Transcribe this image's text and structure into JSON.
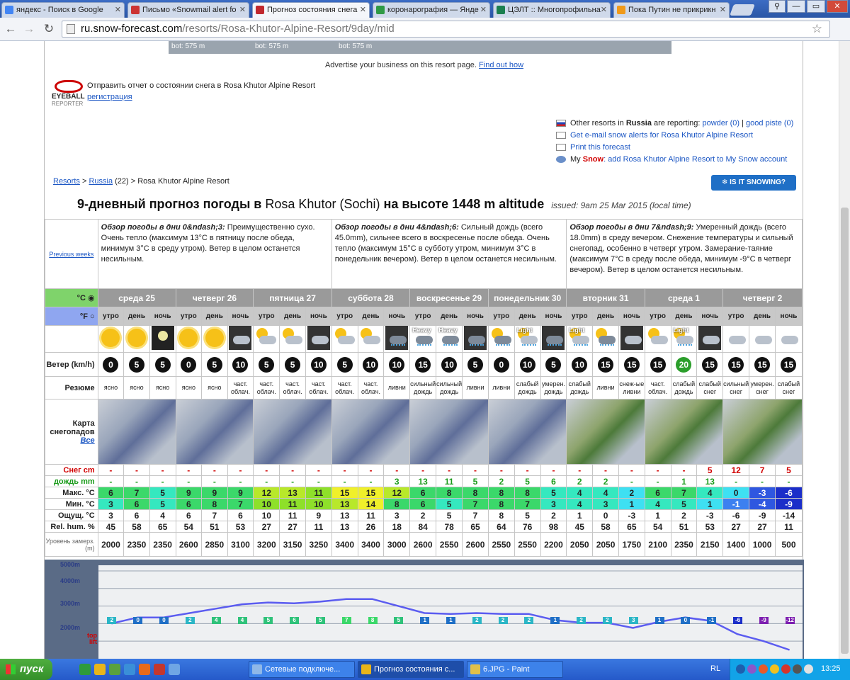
{
  "browser": {
    "tabs": [
      {
        "label": "яндекс - Поиск в Google",
        "color": "#4285f4"
      },
      {
        "label": "Письмо «Snowmail alert fo",
        "color": "#cc3333"
      },
      {
        "label": "Прогноз состояния снега",
        "color": "#c0282e"
      },
      {
        "label": "коронарография — Янде",
        "color": "#2f9a45"
      },
      {
        "label": "ЦЭЛТ :: Многопрофильна",
        "color": "#1b7f4f"
      },
      {
        "label": "Пока Путин не прикрикн",
        "color": "#f09a1a"
      }
    ],
    "url_host": "ru.snow-forecast.com",
    "url_path": "/resorts/Rosa-Khutor-Alpine-Resort/9day/mid",
    "window_buttons": [
      "⚲",
      "—",
      "▭",
      "✕"
    ]
  },
  "top_strip": [
    "bot: 575 m",
    "bot: 575 m",
    "bot: 575 m"
  ],
  "advert": {
    "text": "Advertise your business on this resort page.",
    "link": "Find out how"
  },
  "eyeball": {
    "name": "EYEBALL",
    "sub": "REPORTER",
    "text": "Отправить отчет о состоянии снега в Rosa Khutor Alpine Resort",
    "link": "регистрация"
  },
  "side_links": [
    {
      "prefix": "Other resorts in ",
      "bold": "Russia",
      "mid": " are reporting: ",
      "link1": "powder (0)",
      "sep": " | ",
      "link2": "good piste (0)"
    },
    {
      "link": "Get e-mail snow alerts for Rosa Khutor Alpine Resort"
    },
    {
      "link": "Print this forecast"
    },
    {
      "prefix": "My ",
      "red": "Snow",
      "link": ": add Rosa Khutor Alpine Resort to My Snow account"
    }
  ],
  "breadcrumb": {
    "resorts": "Resorts",
    "sep": " > ",
    "country": "Russia",
    "count": " (22) > ",
    "current": "Rosa Khutor Alpine Resort"
  },
  "snow_button": "❄ IS IT SNOWING?",
  "title": {
    "prefix": "9-дневный прогноз погоды в ",
    "location": "Rosa Khutor (Sochi)",
    "suffix": " на высоте 1448 m altitude",
    "issued": "issued: 9am 25 Mar 2015 (local time)"
  },
  "previous_weeks": "Previous weeks",
  "overviews": [
    {
      "head": "Обзор погоды в дни 0&ndash;3:",
      "text": " Преимущественно сухо. Очень тепло (максимум 13°C в пятницу после обеда, минимум 3°C в среду утром). Ветер в целом останется несильным."
    },
    {
      "head": "Обзор погоды в дни 4&ndash;6:",
      "text": " Сильный дождь (всего 45.0mm), сильнее всего в воскресенье после обеда. Очень тепло (максимум 15°C в субботу утром, минимум 3°C в понедельник вечером). Ветер в целом останется несильным."
    },
    {
      "head": "Обзор погоды в дни 7&ndash;9:",
      "text": " Умеренный дождь (всего 18.0mm) в среду вечером. Снежение температуры и сильный снегопад, особенно в четверг утром. Замерание-таяние (максимум 7°C в среду после обеда, минимум -9°C в четверг вечером). Ветер в целом останется несильным."
    }
  ],
  "units": {
    "c": "°C",
    "f": "°F"
  },
  "days": [
    "среда 25",
    "четверг 26",
    "пятница 27",
    "суббота 28",
    "воскресенье 29",
    "понедельник 30",
    "вторник 31",
    "среда 1",
    "четверг 2"
  ],
  "tod": [
    "утро",
    "день",
    "ночь"
  ],
  "row_labels": {
    "wind": "Ветер (km/h)",
    "summary": "Резюме",
    "map": "Карта снегопадов",
    "map_all": "Все",
    "snow": "Снег cm",
    "rain": "дождь mm",
    "max": "Макс. °C",
    "min": "Мин. °C",
    "feel": "Ощущ. °C",
    "hum": "Rel. hum. %",
    "freeze": "Уровень замерз. (m)"
  },
  "weather_icons": [
    "sun",
    "sun",
    "moon",
    "sun",
    "sun",
    "cloud-night",
    "cloud",
    "cloud",
    "cloud-night",
    "cloud",
    "cloud",
    "rain-night",
    "heavy",
    "heavy",
    "rain-night",
    "cloud-rain",
    "light",
    "rain-night",
    "light",
    "cloud-rain",
    "snow-night",
    "cloud",
    "light",
    "snow-night",
    "snow",
    "snow",
    "snow"
  ],
  "icon_text": {
    "heavy": "Heavy",
    "light": "Light"
  },
  "wind": [
    "0",
    "5",
    "5",
    "0",
    "5",
    "10",
    "5",
    "5",
    "10",
    "5",
    "10",
    "10",
    "15",
    "10",
    "5",
    "0",
    "10",
    "5",
    "10",
    "15",
    "15",
    "15",
    "20",
    "15",
    "15",
    "15",
    "15"
  ],
  "summary": [
    "ясно",
    "ясно",
    "ясно",
    "ясно",
    "ясно",
    "част. облач.",
    "част. облач.",
    "част. облач.",
    "част. облач.",
    "част. облач.",
    "част. облач.",
    "ливни",
    "сильный дождь",
    "сильный дождь",
    "ливни",
    "ливни",
    "слабый дождь",
    "умерен. дождь",
    "слабый дождь",
    "ливни",
    "снеж-ые ливни",
    "част. облач.",
    "слабый дождь",
    "слабый снег",
    "сильный снег",
    "умерен. снег",
    "слабый снег"
  ],
  "snow": [
    "-",
    "-",
    "-",
    "-",
    "-",
    "-",
    "-",
    "-",
    "-",
    "-",
    "-",
    "-",
    "-",
    "-",
    "-",
    "-",
    "-",
    "-",
    "-",
    "-",
    "-",
    "-",
    "-",
    "5",
    "12",
    "7",
    "5"
  ],
  "rain": [
    "-",
    "-",
    "-",
    "-",
    "-",
    "-",
    "-",
    "-",
    "-",
    "-",
    "-",
    "3",
    "13",
    "11",
    "5",
    "2",
    "5",
    "6",
    "2",
    "2",
    "-",
    "-",
    "1",
    "13",
    "-",
    "-",
    "-"
  ],
  "max": [
    "6",
    "7",
    "5",
    "9",
    "9",
    "9",
    "12",
    "13",
    "11",
    "15",
    "15",
    "12",
    "6",
    "8",
    "8",
    "8",
    "8",
    "5",
    "4",
    "4",
    "2",
    "6",
    "7",
    "4",
    "0",
    "-3",
    "-6"
  ],
  "min": [
    "3",
    "6",
    "5",
    "6",
    "8",
    "7",
    "10",
    "11",
    "10",
    "13",
    "14",
    "8",
    "6",
    "5",
    "7",
    "8",
    "7",
    "3",
    "4",
    "3",
    "1",
    "4",
    "5",
    "1",
    "-1",
    "-4",
    "-9"
  ],
  "feel": [
    "3",
    "6",
    "4",
    "6",
    "7",
    "6",
    "10",
    "11",
    "9",
    "13",
    "11",
    "3",
    "2",
    "5",
    "7",
    "8",
    "5",
    "2",
    "1",
    "0",
    "-3",
    "1",
    "2",
    "-3",
    "-6",
    "-9",
    "-14"
  ],
  "hum": [
    "45",
    "58",
    "65",
    "54",
    "51",
    "53",
    "27",
    "27",
    "11",
    "13",
    "26",
    "18",
    "84",
    "78",
    "65",
    "64",
    "76",
    "98",
    "45",
    "58",
    "65",
    "54",
    "51",
    "53",
    "27",
    "27",
    "11"
  ],
  "freeze": [
    "2000",
    "2350",
    "2350",
    "2600",
    "2850",
    "3100",
    "3200",
    "3150",
    "3250",
    "3400",
    "3400",
    "3000",
    "2600",
    "2550",
    "2600",
    "2550",
    "2550",
    "2200",
    "2050",
    "2050",
    "1750",
    "2100",
    "2350",
    "2150",
    "1400",
    "1000",
    "500"
  ],
  "chart": {
    "ylabels": [
      "5000m",
      "4000m",
      "3000m",
      "2000m"
    ],
    "top_lift": "top lift",
    "feels_badges": [
      "2",
      "0",
      "0",
      "2",
      "4",
      "4",
      "5",
      "6",
      "5",
      "7",
      "8",
      "5",
      "1",
      "1",
      "2",
      "2",
      "2",
      "1",
      "2",
      "2",
      "3",
      "1",
      "0",
      "-1",
      "-6",
      "-9",
      "-12"
    ]
  },
  "taskbar": {
    "start": "пуск",
    "items": [
      "Сетевые подключе...",
      "Прогноз состояния с...",
      "6.JPG - Paint"
    ],
    "lang": "RL",
    "clock": "13:25"
  },
  "colors": {
    "accent": "#1f6fc6",
    "snow": "#d10000",
    "rain": "#1a9b1a"
  }
}
